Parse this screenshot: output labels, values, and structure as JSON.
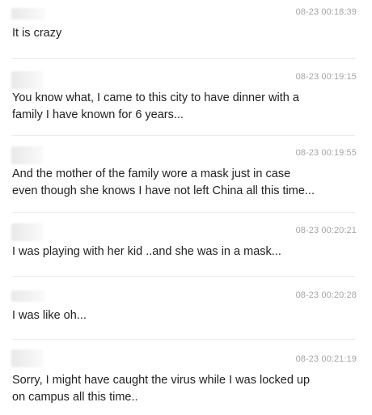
{
  "messages": [
    {
      "time": "08-23 00:18:39",
      "text": "It is crazy"
    },
    {
      "time": "08-23 00:19:15",
      "text": "You know what, I came to this city to have dinner with a\nfamily I have known for 6 years..."
    },
    {
      "time": "08-23 00:19:55",
      "text": "And the mother of the family wore a mask just in case\neven though she knows I have not left China all this time..."
    },
    {
      "time": "08-23 00:20:21",
      "text": "I was playing with her kid ..and she was in a mask..."
    },
    {
      "time": "08-23 00:20:28",
      "text": "I was like oh..."
    },
    {
      "time": "08-23 00:21:19",
      "text": "Sorry, I might have caught the virus while I was locked up\non campus all this time.."
    }
  ],
  "colors": {
    "text": "#222222",
    "timestamp": "#a5a5a5",
    "divider": "#ececec"
  }
}
